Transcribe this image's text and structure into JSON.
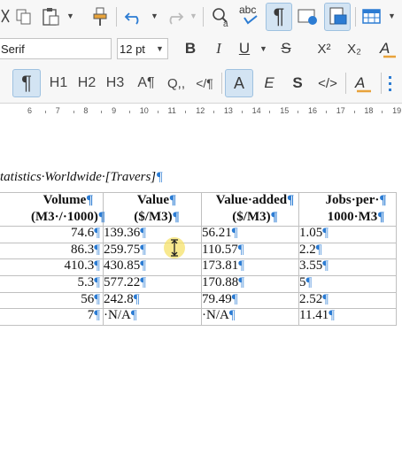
{
  "toolbar": {
    "font_name": "Serif",
    "font_size": "12 pt",
    "bold": "B",
    "italic": "I",
    "underline": "U",
    "strike": "S",
    "superscript": "X²",
    "subscript": "X₂",
    "spellcheck_label": "abc",
    "styles": {
      "paragraph": "¶",
      "heading1": "H1",
      "heading2": "H2",
      "heading3": "H3",
      "text_body": "A¶",
      "quotation": "Q,,",
      "source": "</¶",
      "default_char": "A",
      "emphasis": "E",
      "strong": "S",
      "source_text": "</>"
    }
  },
  "ruler": {
    "marks": [
      "6",
      "7",
      "8",
      "9",
      "10",
      "11",
      "12",
      "13",
      "14",
      "15",
      "16",
      "17",
      "18",
      "19"
    ]
  },
  "document": {
    "caption": "tatistics·Worldwide·[Travers]",
    "pilcrow": "¶",
    "headers": [
      [
        "Volume",
        "(M3·/·1000)"
      ],
      [
        "Value",
        "($/M3)"
      ],
      [
        "Value·added",
        "($/M3)"
      ],
      [
        "Jobs·per·",
        "1000·M3"
      ]
    ],
    "rows": [
      [
        "74.6",
        "139.36",
        "56.21",
        "1.05"
      ],
      [
        "86.3",
        "259.75",
        "110.57",
        "2.2"
      ],
      [
        "410.3",
        "430.85",
        "173.81",
        "3.55"
      ],
      [
        "5.3",
        "577.22",
        "170.88",
        "5"
      ],
      [
        "56",
        "242.8",
        "79.49",
        "2.52"
      ],
      [
        "7",
        "·N/A",
        "·N/A",
        "11.41"
      ]
    ]
  },
  "colors": {
    "accent": "#2c7cd3",
    "toolbar_bg": "#f7f7f7",
    "active_bg": "#d3e4f3",
    "cursor_highlight": "#f5e26a"
  }
}
